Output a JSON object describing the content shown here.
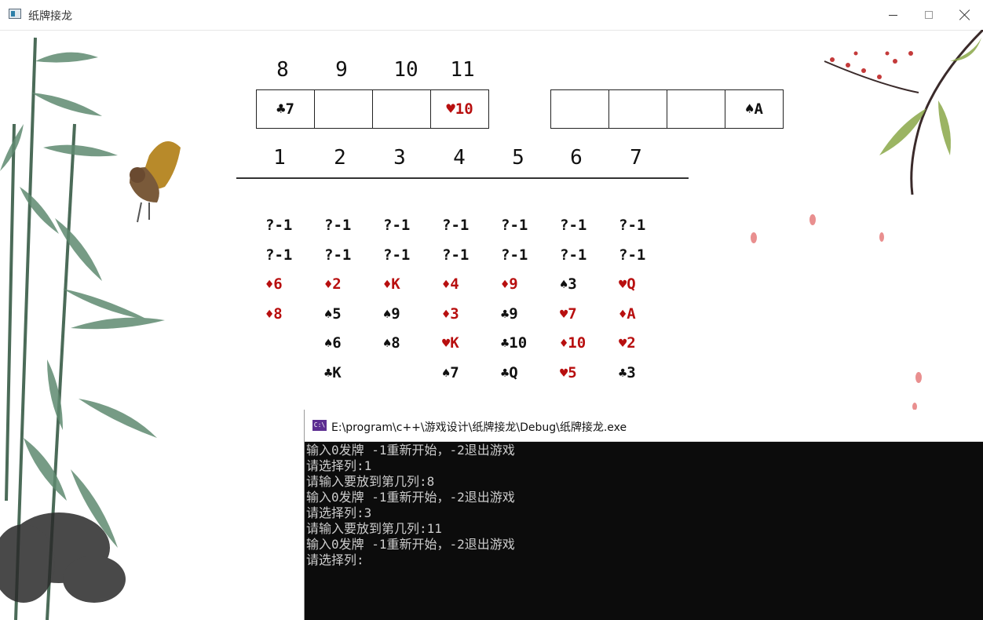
{
  "window": {
    "title": "纸牌接龙",
    "icon": "app-window-icon",
    "controls": [
      "minimize-icon",
      "maximize-icon",
      "close-icon"
    ]
  },
  "game": {
    "free_cell_labels": [
      "8",
      "9",
      "10",
      "11"
    ],
    "free_cells": [
      {
        "card": "7",
        "suit": "♣",
        "color": "black"
      },
      {
        "card": "",
        "suit": "",
        "color": "black"
      },
      {
        "card": "",
        "suit": "",
        "color": "black"
      },
      {
        "card": "10",
        "suit": "♥",
        "color": "red"
      }
    ],
    "foundation_cells": [
      {
        "card": "",
        "suit": "",
        "color": "black"
      },
      {
        "card": "",
        "suit": "",
        "color": "black"
      },
      {
        "card": "",
        "suit": "",
        "color": "black"
      },
      {
        "card": "A",
        "suit": "♠",
        "color": "black"
      }
    ],
    "column_labels": [
      "1",
      "2",
      "3",
      "4",
      "5",
      "6",
      "7"
    ],
    "columns": [
      [
        {
          "text": "?-1",
          "suit": "",
          "color": "black"
        },
        {
          "text": "?-1",
          "suit": "",
          "color": "black"
        },
        {
          "text": "6",
          "suit": "♦",
          "color": "red"
        },
        {
          "text": "8",
          "suit": "♦",
          "color": "red"
        }
      ],
      [
        {
          "text": "?-1",
          "suit": "",
          "color": "black"
        },
        {
          "text": "?-1",
          "suit": "",
          "color": "black"
        },
        {
          "text": "2",
          "suit": "♦",
          "color": "red"
        },
        {
          "text": "5",
          "suit": "♠",
          "color": "black"
        },
        {
          "text": "6",
          "suit": "♠",
          "color": "black"
        },
        {
          "text": "K",
          "suit": "♣",
          "color": "black"
        }
      ],
      [
        {
          "text": "?-1",
          "suit": "",
          "color": "black"
        },
        {
          "text": "?-1",
          "suit": "",
          "color": "black"
        },
        {
          "text": "K",
          "suit": "♦",
          "color": "red"
        },
        {
          "text": "9",
          "suit": "♠",
          "color": "black"
        },
        {
          "text": "8",
          "suit": "♠",
          "color": "black"
        }
      ],
      [
        {
          "text": "?-1",
          "suit": "",
          "color": "black"
        },
        {
          "text": "?-1",
          "suit": "",
          "color": "black"
        },
        {
          "text": "4",
          "suit": "♦",
          "color": "red"
        },
        {
          "text": "3",
          "suit": "♦",
          "color": "red"
        },
        {
          "text": "K",
          "suit": "♥",
          "color": "red"
        },
        {
          "text": "7",
          "suit": "♠",
          "color": "black"
        }
      ],
      [
        {
          "text": "?-1",
          "suit": "",
          "color": "black"
        },
        {
          "text": "?-1",
          "suit": "",
          "color": "black"
        },
        {
          "text": "9",
          "suit": "♦",
          "color": "red"
        },
        {
          "text": "9",
          "suit": "♣",
          "color": "black"
        },
        {
          "text": "10",
          "suit": "♣",
          "color": "black"
        },
        {
          "text": "Q",
          "suit": "♣",
          "color": "black"
        }
      ],
      [
        {
          "text": "?-1",
          "suit": "",
          "color": "black"
        },
        {
          "text": "?-1",
          "suit": "",
          "color": "black"
        },
        {
          "text": "3",
          "suit": "♠",
          "color": "black"
        },
        {
          "text": "7",
          "suit": "♥",
          "color": "red"
        },
        {
          "text": "10",
          "suit": "♦",
          "color": "red"
        },
        {
          "text": "5",
          "suit": "♥",
          "color": "red"
        }
      ],
      [
        {
          "text": "?-1",
          "suit": "",
          "color": "black"
        },
        {
          "text": "?-1",
          "suit": "",
          "color": "black"
        },
        {
          "text": "Q",
          "suit": "♥",
          "color": "red"
        },
        {
          "text": "A",
          "suit": "♦",
          "color": "red"
        },
        {
          "text": "2",
          "suit": "♥",
          "color": "red"
        },
        {
          "text": "3",
          "suit": "♣",
          "color": "black"
        }
      ]
    ],
    "colors": {
      "red": "#b80f0f",
      "black": "#111111"
    }
  },
  "console": {
    "title": "E:\\program\\c++\\游戏设计\\纸牌接龙\\Debug\\纸牌接龙.exe",
    "icon_text": "C:\\",
    "lines": [
      "输入0发牌 -1重新开始，-2退出游戏",
      "请选择列:1",
      "请输入要放到第几列:8",
      "输入0发牌 -1重新开始，-2退出游戏",
      "请选择列:3",
      "请输入要放到第几列:11",
      "输入0发牌 -1重新开始，-2退出游戏",
      "请选择列:"
    ],
    "colors": {
      "background": "#0c0c0c",
      "text": "#cccccc"
    }
  }
}
